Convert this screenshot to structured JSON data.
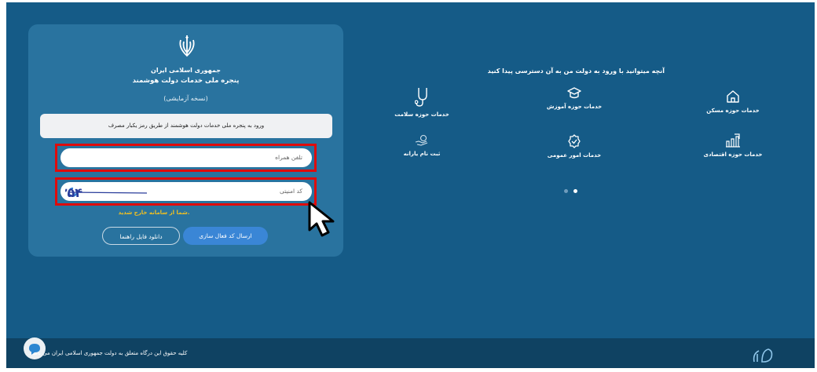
{
  "login_card": {
    "title_1": "جمهوری اسلامی ایران",
    "title_2": "پنجره ملی خدمات دولت هوشمند",
    "version": "(نسخه آزمایشی)",
    "notice": "ورود به پنجره ملی خدمات دولت هوشمند از طریق رمز یکبار مصرف",
    "phone_placeholder": "تلفن همراه",
    "captcha_placeholder": "کد امنیتی",
    "captcha_code": "۳۹۳۵۴",
    "error": "شما از سامانه خارج شدید.",
    "send_button": "ارسال کد فعال سازی",
    "download_button": "دانلود فایل راهنما"
  },
  "services": {
    "title": "آنچه میتوانید با ورود به دولت من به آن دسترسی پیدا کنید",
    "items": [
      {
        "label": "خدمات حوزه مسکن",
        "icon": "house-icon"
      },
      {
        "label": "خدمات حوزه آموزش",
        "icon": "graduation-cap-icon"
      },
      {
        "label": "خدمات حوزه سلامت",
        "icon": "stethoscope-icon"
      },
      {
        "label": "خدمات حوزه اقتصادی",
        "icon": "bar-chart-icon"
      },
      {
        "label": "خدمات امور عمومی",
        "icon": "badge-check-icon"
      },
      {
        "label": "ثبت نام یارانه",
        "icon": "hand-coin-icon"
      }
    ],
    "active_dot": 1
  },
  "footer": {
    "copyright": "کلیه حقوق این درگاه متعلق به دولت جمهوری اسلامی ایران می باشد."
  },
  "colors": {
    "background": "#155b87",
    "card": "#29739f",
    "highlight": "#e00b0b",
    "primary_button": "#3a86d6",
    "error": "#f2c020",
    "footer": "#0f4262"
  }
}
